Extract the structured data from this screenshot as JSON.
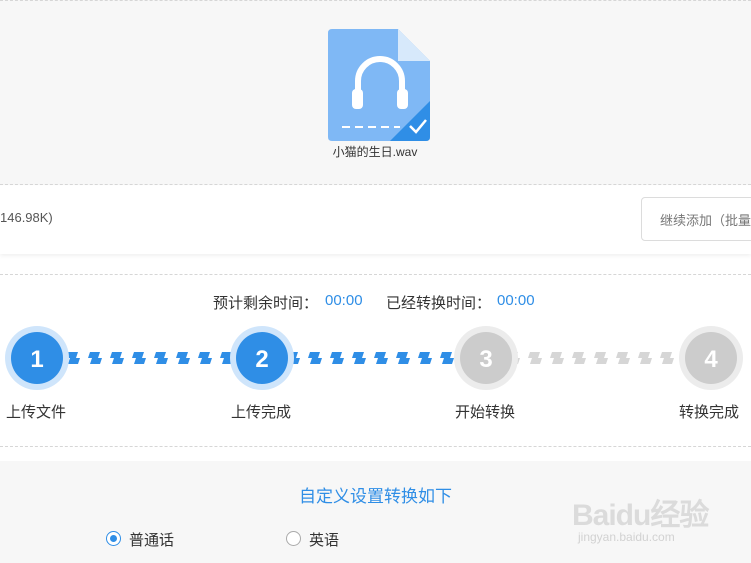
{
  "upload": {
    "file_name": "小猫的生日.wav",
    "file_icon": "headphones-audio-file-icon",
    "uploaded_check_icon": "checkmark-icon"
  },
  "info_bar": {
    "file_size": "146.98K)",
    "continue_add_label": "继续添加（批量"
  },
  "timer": {
    "remaining_label": "预计剩余时间：",
    "remaining_value": "00:00",
    "elapsed_label": "已经转换时间：",
    "elapsed_value": "00:00"
  },
  "steps": [
    {
      "number": "1",
      "label": "上传文件",
      "status": "done"
    },
    {
      "number": "2",
      "label": "上传完成",
      "status": "done"
    },
    {
      "number": "3",
      "label": "开始转换",
      "status": "pending"
    },
    {
      "number": "4",
      "label": "转换完成",
      "status": "pending"
    }
  ],
  "settings": {
    "title": "自定义设置转换如下",
    "options": [
      {
        "label": "普通话",
        "checked": true
      },
      {
        "label": "英语",
        "checked": false
      }
    ]
  },
  "watermark": {
    "text": "Baidu经验",
    "url": "jingyan.baidu.com"
  },
  "colors": {
    "accent": "#2f8ee6",
    "step_done": "#2f8ee6",
    "step_pending": "#cccccc",
    "panel_bg": "#f7f7f7"
  }
}
